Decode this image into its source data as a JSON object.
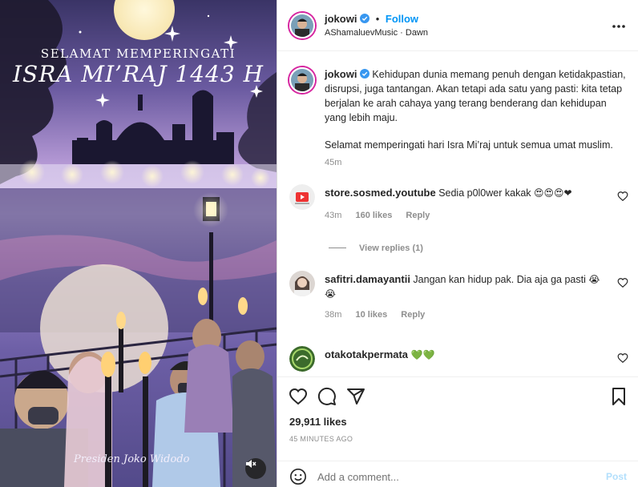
{
  "media": {
    "subtitle": "SELAMAT MEMPERINGATI",
    "title": "ISRA MI’RAJ 1443 H",
    "signature": "Presiden Joko Widodo",
    "mute_icon": "speaker-muted-icon"
  },
  "header": {
    "username": "jokowi",
    "separator": "•",
    "follow_label": "Follow",
    "audio": "AShamaluevMusic · Dawn",
    "more_icon": "more-horizontal-icon"
  },
  "caption": {
    "username": "jokowi",
    "paragraph1": "Kehidupan dunia memang penuh dengan ketidakpastian, disrupsi, juga tantangan. Akan tetapi ada satu yang pasti: kita tetap berjalan ke arah cahaya yang terang benderang dan kehidupan yang lebih maju.",
    "paragraph2": "Selamat memperingati hari Isra Mi’raj untuk semua umat muslim.",
    "time": "45m"
  },
  "comments": [
    {
      "username": "store.sosmed.youtube",
      "text": "Sedia p0l0wer kakak",
      "emoji": "😍😍😍❤",
      "time": "43m",
      "likes": "160 likes",
      "reply": "Reply"
    },
    {
      "username": "safitri.damayantii",
      "text": "Jangan kan hidup pak. Dia aja ga pasti",
      "emoji": "😭",
      "emoji2": "😭",
      "time": "38m",
      "likes": "10 likes",
      "reply": "Reply"
    },
    {
      "username": "otakotakpermata",
      "text": "",
      "emoji": "💚💚",
      "time": "",
      "likes": "",
      "reply": ""
    }
  ],
  "view_replies": "View replies (1)",
  "actions": {
    "likes": "29,911 likes",
    "time": "45 MINUTES AGO",
    "comment_placeholder": "Add a comment...",
    "post_label": "Post"
  },
  "colors": {
    "accent": "#0095f6",
    "verified": "#3897f0",
    "heart_red": "#ed4956",
    "green_heart": "#2fcc2f"
  }
}
